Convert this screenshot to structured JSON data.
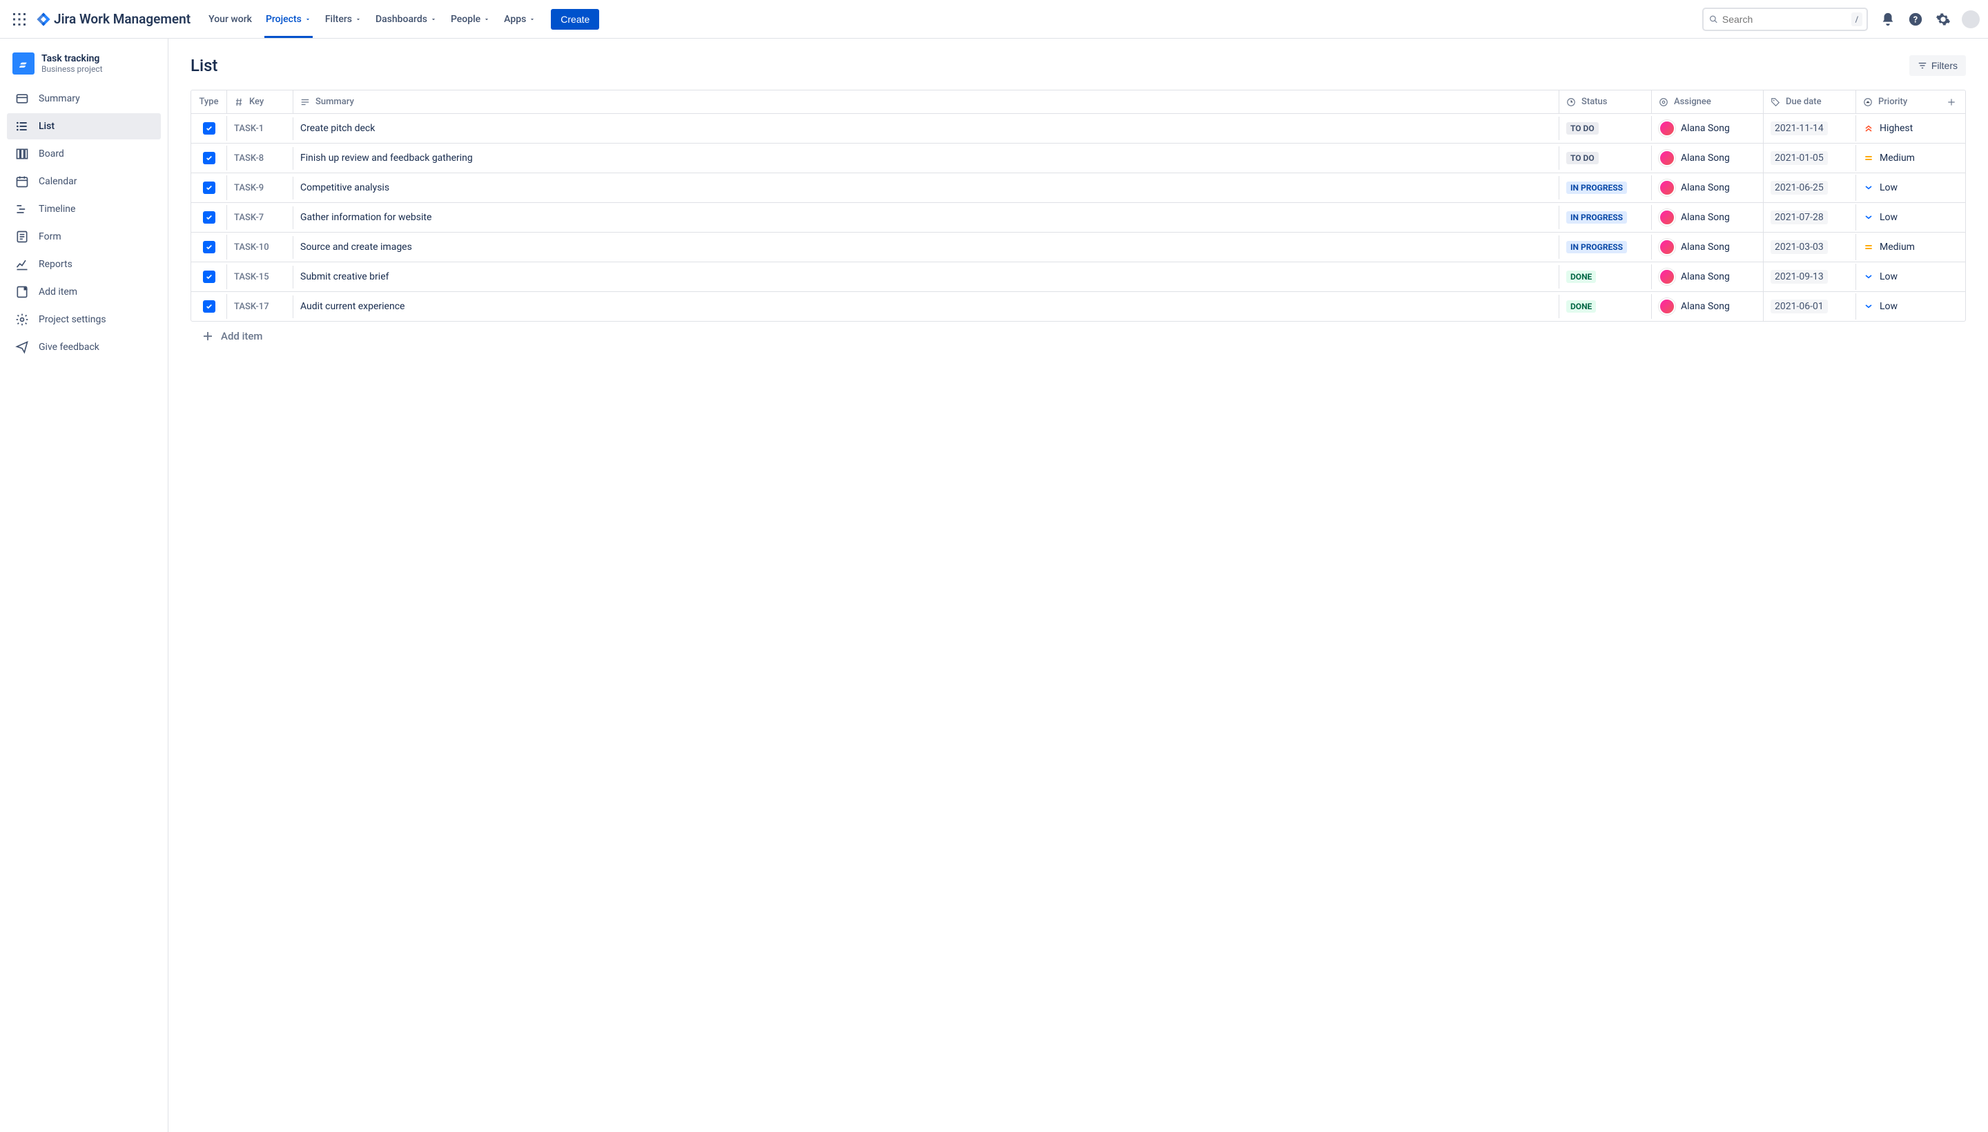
{
  "app": {
    "name": "Jira Work Management"
  },
  "nav": {
    "items": [
      {
        "label": "Your work",
        "dropdown": false
      },
      {
        "label": "Projects",
        "dropdown": true,
        "active": true
      },
      {
        "label": "Filters",
        "dropdown": true
      },
      {
        "label": "Dashboards",
        "dropdown": true
      },
      {
        "label": "People",
        "dropdown": true
      },
      {
        "label": "Apps",
        "dropdown": true
      }
    ],
    "create": "Create"
  },
  "search": {
    "placeholder": "Search",
    "shortcut": "/"
  },
  "project": {
    "name": "Task tracking",
    "type": "Business project"
  },
  "sidebar": {
    "items": [
      {
        "label": "Summary",
        "icon": "card"
      },
      {
        "label": "List",
        "icon": "list",
        "active": true
      },
      {
        "label": "Board",
        "icon": "board"
      },
      {
        "label": "Calendar",
        "icon": "calendar"
      },
      {
        "label": "Timeline",
        "icon": "timeline"
      },
      {
        "label": "Form",
        "icon": "form"
      },
      {
        "label": "Reports",
        "icon": "reports"
      },
      {
        "label": "Add item",
        "icon": "add"
      },
      {
        "label": "Project settings",
        "icon": "settings"
      },
      {
        "label": "Give feedback",
        "icon": "feedback"
      }
    ]
  },
  "page": {
    "title": "List",
    "filters": "Filters",
    "addItem": "Add item"
  },
  "columns": {
    "type": "Type",
    "key": "Key",
    "summary": "Summary",
    "status": "Status",
    "assignee": "Assignee",
    "due": "Due date",
    "priority": "Priority"
  },
  "rows": [
    {
      "key": "TASK-1",
      "summary": "Create pitch deck",
      "status": "TO DO",
      "statusClass": "todo",
      "assignee": "Alana Song",
      "due": "2021-11-14",
      "priority": "Highest",
      "priIcon": "highest"
    },
    {
      "key": "TASK-8",
      "summary": "Finish up review and feedback gathering",
      "status": "TO DO",
      "statusClass": "todo",
      "assignee": "Alana Song",
      "due": "2021-01-05",
      "priority": "Medium",
      "priIcon": "medium"
    },
    {
      "key": "TASK-9",
      "summary": "Competitive analysis",
      "status": "IN PROGRESS",
      "statusClass": "inprog",
      "assignee": "Alana Song",
      "due": "2021-06-25",
      "priority": "Low",
      "priIcon": "low"
    },
    {
      "key": "TASK-7",
      "summary": "Gather information for website",
      "status": "IN PROGRESS",
      "statusClass": "inprog",
      "assignee": "Alana Song",
      "due": "2021-07-28",
      "priority": "Low",
      "priIcon": "low"
    },
    {
      "key": "TASK-10",
      "summary": "Source and create images",
      "status": "IN PROGRESS",
      "statusClass": "inprog",
      "assignee": "Alana Song",
      "due": "2021-03-03",
      "priority": "Medium",
      "priIcon": "medium"
    },
    {
      "key": "TASK-15",
      "summary": "Submit creative brief",
      "status": "DONE",
      "statusClass": "done",
      "assignee": "Alana Song",
      "due": "2021-09-13",
      "priority": "Low",
      "priIcon": "low"
    },
    {
      "key": "TASK-17",
      "summary": "Audit current experience",
      "status": "DONE",
      "statusClass": "done",
      "assignee": "Alana Song",
      "due": "2021-06-01",
      "priority": "Low",
      "priIcon": "low"
    }
  ]
}
